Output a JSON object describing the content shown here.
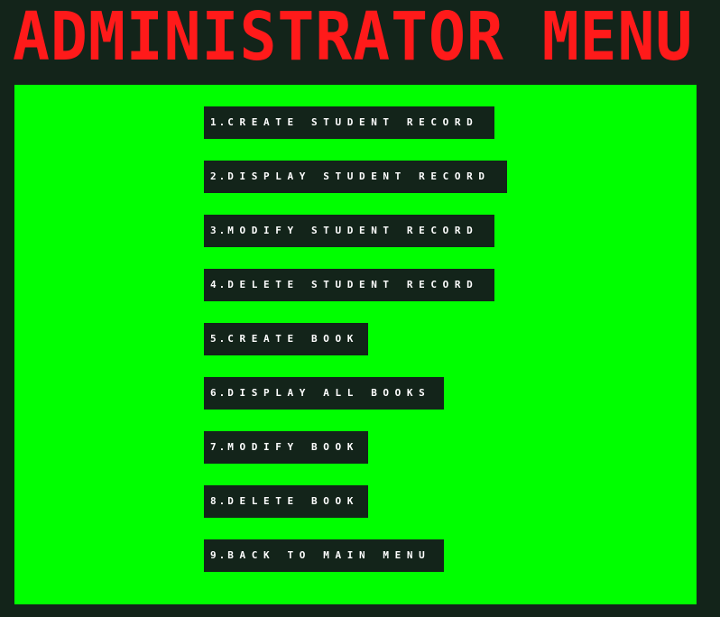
{
  "title": "ADMINISTRATOR MENU",
  "menu": {
    "items": [
      {
        "label": "1.CREATE STUDENT RECORD"
      },
      {
        "label": "2.DISPLAY STUDENT RECORD"
      },
      {
        "label": "3.MODIFY STUDENT RECORD"
      },
      {
        "label": "4.DELETE STUDENT RECORD"
      },
      {
        "label": "5.CREATE BOOK"
      },
      {
        "label": "6.DISPLAY ALL BOOKS"
      },
      {
        "label": "7.MODIFY BOOK"
      },
      {
        "label": "8.DELETE BOOK"
      },
      {
        "label": "9.BACK TO MAIN MENU"
      }
    ]
  },
  "colors": {
    "background": "#13241a",
    "panel": "#00ff00",
    "title": "#ff1a1a",
    "item_text": "#ffffff"
  }
}
